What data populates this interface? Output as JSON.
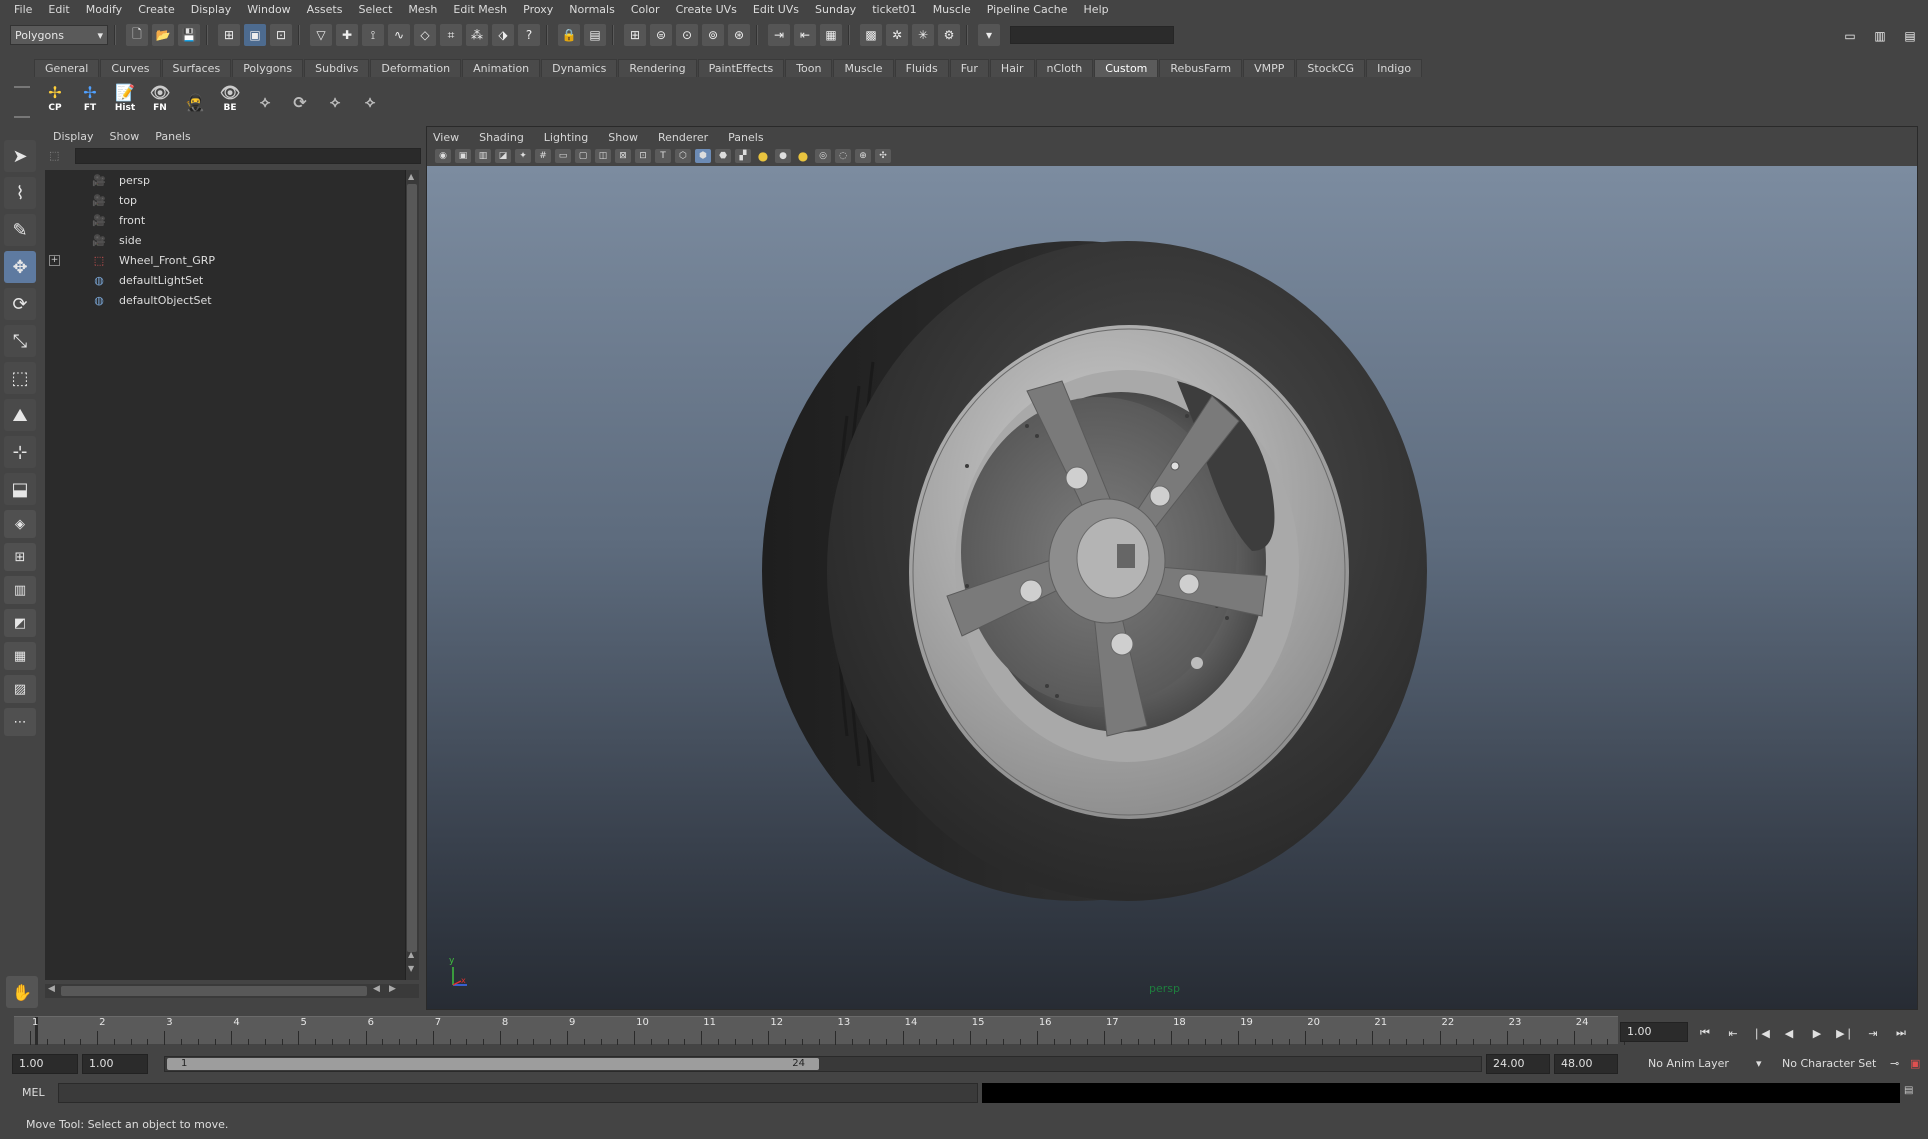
{
  "menubar": [
    "File",
    "Edit",
    "Modify",
    "Create",
    "Display",
    "Window",
    "Assets",
    "Select",
    "Mesh",
    "Edit Mesh",
    "Proxy",
    "Normals",
    "Color",
    "Create UVs",
    "Edit UVs",
    "Sunday",
    "ticket01",
    "Muscle",
    "Pipeline Cache",
    "Help"
  ],
  "statusline": {
    "mode": "Polygons"
  },
  "shelf": {
    "tabs": [
      "General",
      "Curves",
      "Surfaces",
      "Polygons",
      "Subdivs",
      "Deformation",
      "Animation",
      "Dynamics",
      "Rendering",
      "PaintEffects",
      "Toon",
      "Muscle",
      "Fluids",
      "Fur",
      "Hair",
      "nCloth",
      "Custom",
      "RebusFarm",
      "VMPP",
      "StockCG",
      "Indigo"
    ],
    "active_tab": "Custom",
    "buttons": [
      "CP",
      "FT",
      "Hist",
      "FN",
      "",
      "BE",
      "",
      "",
      "",
      ""
    ]
  },
  "outliner": {
    "menu": [
      "Display",
      "Show",
      "Panels"
    ],
    "items": [
      {
        "label": "persp",
        "icon": "camera-icon",
        "expandable": false
      },
      {
        "label": "top",
        "icon": "camera-icon",
        "expandable": false
      },
      {
        "label": "front",
        "icon": "camera-icon",
        "expandable": false
      },
      {
        "label": "side",
        "icon": "camera-icon",
        "expandable": false
      },
      {
        "label": "Wheel_Front_GRP",
        "icon": "group-icon",
        "expandable": true
      },
      {
        "label": "defaultLightSet",
        "icon": "set-icon",
        "expandable": false
      },
      {
        "label": "defaultObjectSet",
        "icon": "set-icon",
        "expandable": false
      }
    ]
  },
  "viewport": {
    "menu": [
      "View",
      "Shading",
      "Lighting",
      "Show",
      "Renderer",
      "Panels"
    ],
    "camera_label": "persp",
    "axis": {
      "y": "y",
      "x": "x"
    }
  },
  "timeslider": {
    "ticks": [
      "1",
      "2",
      "3",
      "4",
      "5",
      "6",
      "7",
      "8",
      "9",
      "10",
      "11",
      "12",
      "13",
      "14",
      "15",
      "16",
      "17",
      "18",
      "19",
      "20",
      "21",
      "22",
      "23",
      "24"
    ],
    "current_time": "1.00"
  },
  "rangeslider": {
    "start_time": "1.00",
    "playback_start": "1.00",
    "range_start_label": "1",
    "range_end_label": "24",
    "playback_end": "24.00",
    "end_time": "48.00",
    "anim_layer": "No Anim Layer",
    "character_set": "No Character Set"
  },
  "cmdline": {
    "label": "MEL"
  },
  "helpline": {
    "text": "Move Tool: Select an object to move."
  }
}
